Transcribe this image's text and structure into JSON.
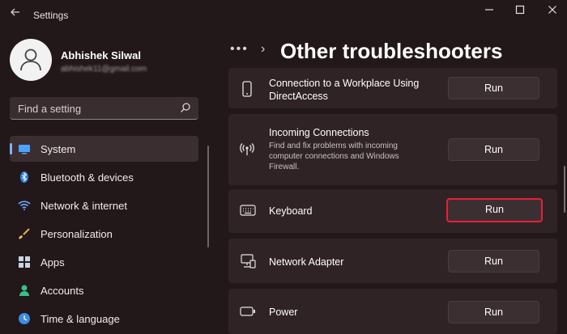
{
  "window": {
    "title": "Settings",
    "back_icon": "back-arrow-icon",
    "controls": [
      "minimize-icon",
      "maximize-icon",
      "close-icon"
    ]
  },
  "user": {
    "name": "Abhishek Silwal",
    "email": "abhishek11@gmail.com"
  },
  "search": {
    "placeholder": "Find a setting"
  },
  "nav": {
    "items": [
      {
        "label": "System",
        "icon": "system-monitor-icon",
        "active": true
      },
      {
        "label": "Bluetooth & devices",
        "icon": "bluetooth-icon"
      },
      {
        "label": "Network & internet",
        "icon": "wifi-icon"
      },
      {
        "label": "Personalization",
        "icon": "paintbrush-icon"
      },
      {
        "label": "Apps",
        "icon": "apps-icon"
      },
      {
        "label": "Accounts",
        "icon": "accounts-icon"
      },
      {
        "label": "Time & language",
        "icon": "globe-clock-icon"
      }
    ]
  },
  "header": {
    "more": "•••",
    "chevron": "›",
    "title": "Other troubleshooters"
  },
  "troubleshooters": [
    {
      "title": "Connection to a Workplace Using DirectAccess",
      "description": "",
      "icon": "phone-device-icon",
      "button": "Run"
    },
    {
      "title": "Incoming Connections",
      "description": "Find and fix problems with incoming computer connections and Windows Firewall.",
      "icon": "antenna-icon",
      "button": "Run"
    },
    {
      "title": "Keyboard",
      "description": "",
      "icon": "keyboard-icon",
      "button": "Run",
      "highlighted": true
    },
    {
      "title": "Network Adapter",
      "description": "",
      "icon": "network-adapter-icon",
      "button": "Run"
    },
    {
      "title": "Power",
      "description": "",
      "icon": "battery-icon",
      "button": "Run"
    }
  ],
  "colors": {
    "background": "#221719",
    "card": "#2f2325",
    "accent": "#7fb2ff",
    "highlight_border": "#e81e39"
  }
}
